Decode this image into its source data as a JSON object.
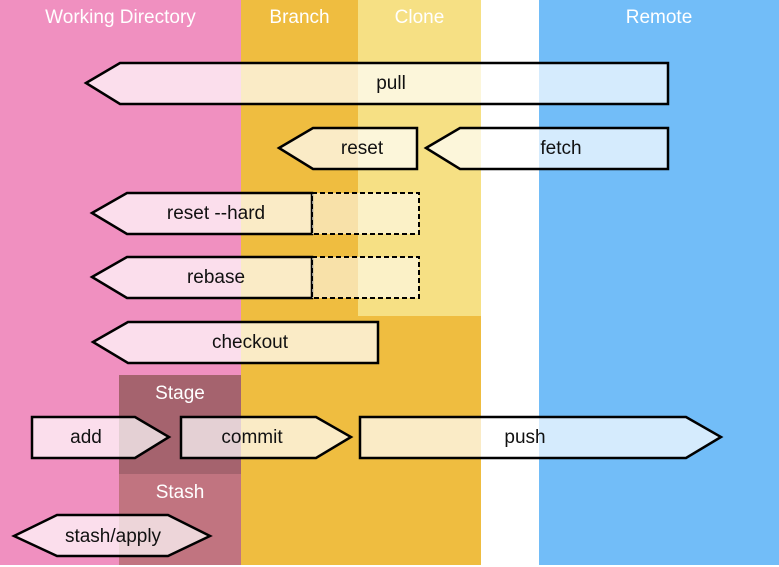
{
  "columns": {
    "working_directory": {
      "label": "Working Directory",
      "color": "#f090c0"
    },
    "branch": {
      "label": "Branch",
      "color": "#efbd40"
    },
    "clone": {
      "label": "Clone",
      "color": "#f6e084"
    },
    "remote": {
      "label": "Remote",
      "color": "#72bdf8"
    }
  },
  "areas": {
    "stage": {
      "label": "Stage",
      "color": "#a5636e"
    },
    "stash": {
      "label": "Stash",
      "color": "#c17480"
    }
  },
  "arrows": [
    {
      "id": "pull",
      "label": "pull",
      "direction": "left",
      "from": "Remote",
      "to": "Working Directory"
    },
    {
      "id": "reset",
      "label": "reset",
      "direction": "left",
      "from": "Clone",
      "to": "Branch"
    },
    {
      "id": "fetch",
      "label": "fetch",
      "direction": "left",
      "from": "Remote",
      "to": "Clone"
    },
    {
      "id": "reset-hard",
      "label": "reset --hard",
      "direction": "left",
      "from": "Clone",
      "to": "Working Directory",
      "dashed_extension": true
    },
    {
      "id": "rebase",
      "label": "rebase",
      "direction": "left",
      "from": "Clone",
      "to": "Working Directory",
      "dashed_extension": true
    },
    {
      "id": "checkout",
      "label": "checkout",
      "direction": "left",
      "from": "Branch",
      "to": "Working Directory"
    },
    {
      "id": "add",
      "label": "add",
      "direction": "right",
      "from": "Working Directory",
      "to": "Stage"
    },
    {
      "id": "commit",
      "label": "commit",
      "direction": "right",
      "from": "Stage",
      "to": "Branch"
    },
    {
      "id": "push",
      "label": "push",
      "direction": "right",
      "from": "Branch",
      "to": "Remote"
    },
    {
      "id": "stash-apply",
      "label": "stash/apply",
      "direction": "both",
      "from": "Working Directory",
      "to": "Stash"
    }
  ]
}
